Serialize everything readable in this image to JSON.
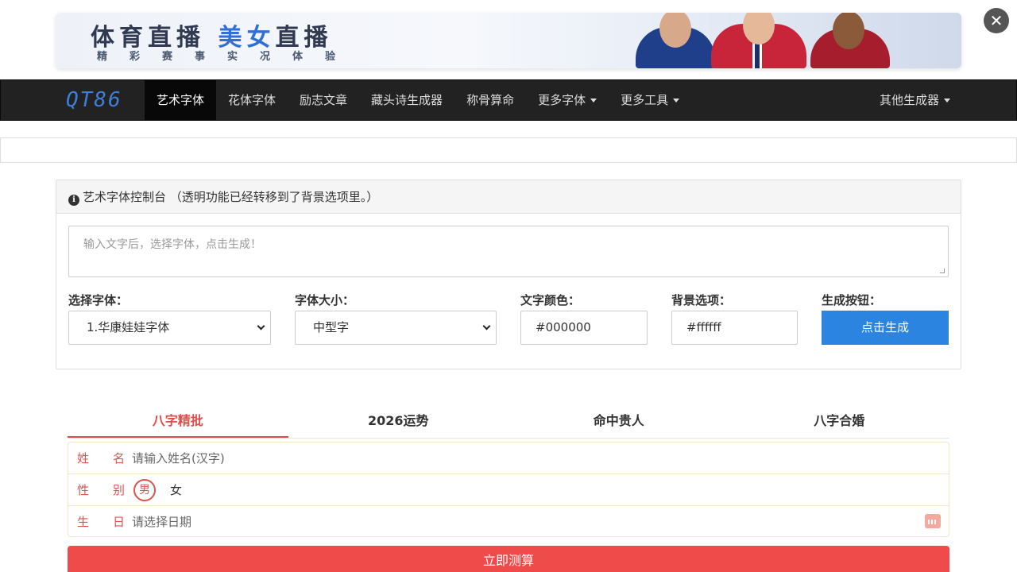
{
  "banner": {
    "title_part1": "体育直播",
    "title_part2": "美女",
    "title_part3": "直播",
    "subtitle": "精彩赛事实况体验"
  },
  "close_label": "✕",
  "navbar": {
    "brand": "QT86",
    "items": [
      {
        "label": "艺术字体",
        "active": true
      },
      {
        "label": "花体字体"
      },
      {
        "label": "励志文章"
      },
      {
        "label": "藏头诗生成器"
      },
      {
        "label": "称骨算命"
      },
      {
        "label": "更多字体",
        "dropdown": true
      },
      {
        "label": "更多工具",
        "dropdown": true
      }
    ],
    "right_item": "其他生成器"
  },
  "panel": {
    "heading": "艺术字体控制台 （透明功能已经转移到了背景选项里。）",
    "textarea_placeholder": "输入文字后，选择字体，点击生成！",
    "font_label": "选择字体：",
    "font_value": "1.华康娃娃字体",
    "size_label": "字体大小：",
    "size_value": "中型字",
    "color_label": "文字颜色：",
    "color_value": "#000000",
    "bg_label": "背景选项：",
    "bg_value": "#ffffff",
    "button_label": "生成按钮：",
    "button_text": "点击生成"
  },
  "tabs": [
    {
      "label": "八字精批",
      "active": true
    },
    {
      "label": "2026运势"
    },
    {
      "label": "命中贵人"
    },
    {
      "label": "八字合婚"
    }
  ],
  "form": {
    "name_label": "姓名",
    "name_placeholder": "请输入姓名(汉字)",
    "gender_label": "性别",
    "gender_male": "男",
    "gender_female": "女",
    "birth_label": "生日",
    "birth_placeholder": "请选择日期",
    "submit": "立即测算"
  },
  "colors": {
    "nav_bg": "#222222",
    "primary_blue": "#2b84e0",
    "accent_red": "#e04b4b"
  }
}
